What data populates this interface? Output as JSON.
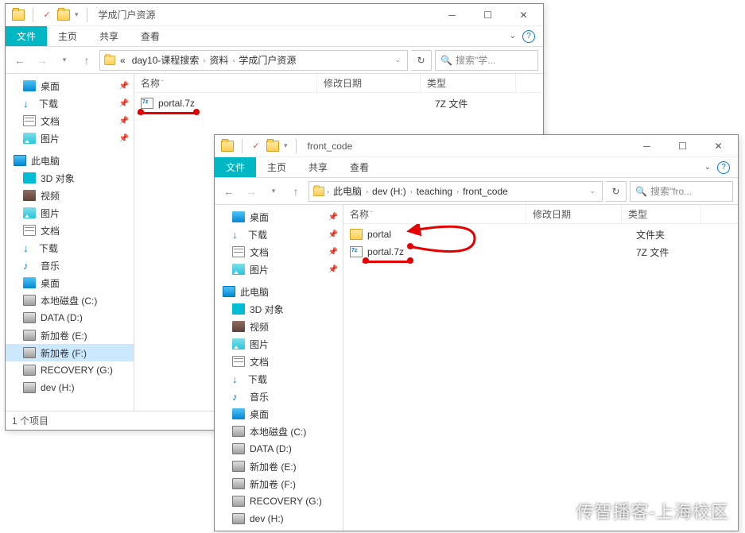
{
  "window1": {
    "title": "学成门户资源",
    "tabs": {
      "file": "文件",
      "home": "主页",
      "share": "共享",
      "view": "查看"
    },
    "breadcrumbs": [
      "day10-课程搜索",
      "资料",
      "学成门户资源"
    ],
    "breadcrumb_prefix": "«",
    "search_placeholder": "搜索\"学...",
    "columns": {
      "name": "名称",
      "modified": "修改日期",
      "type": "类型"
    },
    "files": [
      {
        "name": "portal.7z",
        "type": "7Z 文件"
      }
    ],
    "status": "1 个项目",
    "sidebar_quick": [
      {
        "label": "桌面",
        "pinned": true,
        "icon": "desktop"
      },
      {
        "label": "下载",
        "pinned": true,
        "icon": "download"
      },
      {
        "label": "文档",
        "pinned": true,
        "icon": "doc"
      },
      {
        "label": "图片",
        "pinned": true,
        "icon": "pic"
      }
    ],
    "sidebar_pc": "此电脑",
    "sidebar_pc_items": [
      {
        "label": "3D 对象",
        "icon": "3d"
      },
      {
        "label": "视频",
        "icon": "video"
      },
      {
        "label": "图片",
        "icon": "pic"
      },
      {
        "label": "文档",
        "icon": "doc"
      },
      {
        "label": "下载",
        "icon": "download"
      },
      {
        "label": "音乐",
        "icon": "music"
      },
      {
        "label": "桌面",
        "icon": "desktop"
      },
      {
        "label": "本地磁盘 (C:)",
        "icon": "drive"
      },
      {
        "label": "DATA (D:)",
        "icon": "drive"
      },
      {
        "label": "新加卷 (E:)",
        "icon": "drive"
      },
      {
        "label": "新加卷 (F:)",
        "icon": "drive",
        "selected": true
      },
      {
        "label": "RECOVERY (G:)",
        "icon": "drive"
      },
      {
        "label": "dev (H:)",
        "icon": "drive"
      }
    ]
  },
  "window2": {
    "title": "front_code",
    "tabs": {
      "file": "文件",
      "home": "主页",
      "share": "共享",
      "view": "查看"
    },
    "breadcrumbs": [
      "此电脑",
      "dev (H:)",
      "teaching",
      "front_code"
    ],
    "search_placeholder": "搜索\"fro...",
    "columns": {
      "name": "名称",
      "modified": "修改日期",
      "type": "类型"
    },
    "files": [
      {
        "name": "portal",
        "type": "文件夹",
        "icon": "folder"
      },
      {
        "name": "portal.7z",
        "type": "7Z 文件",
        "icon": "7z"
      }
    ],
    "sidebar_quick": [
      {
        "label": "桌面",
        "pinned": true,
        "icon": "desktop"
      },
      {
        "label": "下载",
        "pinned": true,
        "icon": "download"
      },
      {
        "label": "文档",
        "pinned": true,
        "icon": "doc"
      },
      {
        "label": "图片",
        "pinned": true,
        "icon": "pic"
      }
    ],
    "sidebar_pc": "此电脑",
    "sidebar_pc_items": [
      {
        "label": "3D 对象",
        "icon": "3d"
      },
      {
        "label": "视频",
        "icon": "video"
      },
      {
        "label": "图片",
        "icon": "pic"
      },
      {
        "label": "文档",
        "icon": "doc"
      },
      {
        "label": "下载",
        "icon": "download"
      },
      {
        "label": "音乐",
        "icon": "music"
      },
      {
        "label": "桌面",
        "icon": "desktop"
      },
      {
        "label": "本地磁盘 (C:)",
        "icon": "drive"
      },
      {
        "label": "DATA (D:)",
        "icon": "drive"
      },
      {
        "label": "新加卷 (E:)",
        "icon": "drive"
      },
      {
        "label": "新加卷 (F:)",
        "icon": "drive"
      },
      {
        "label": "RECOVERY (G:)",
        "icon": "drive"
      },
      {
        "label": "dev (H:)",
        "icon": "drive"
      }
    ]
  },
  "watermark": "传智播客-上海校区"
}
